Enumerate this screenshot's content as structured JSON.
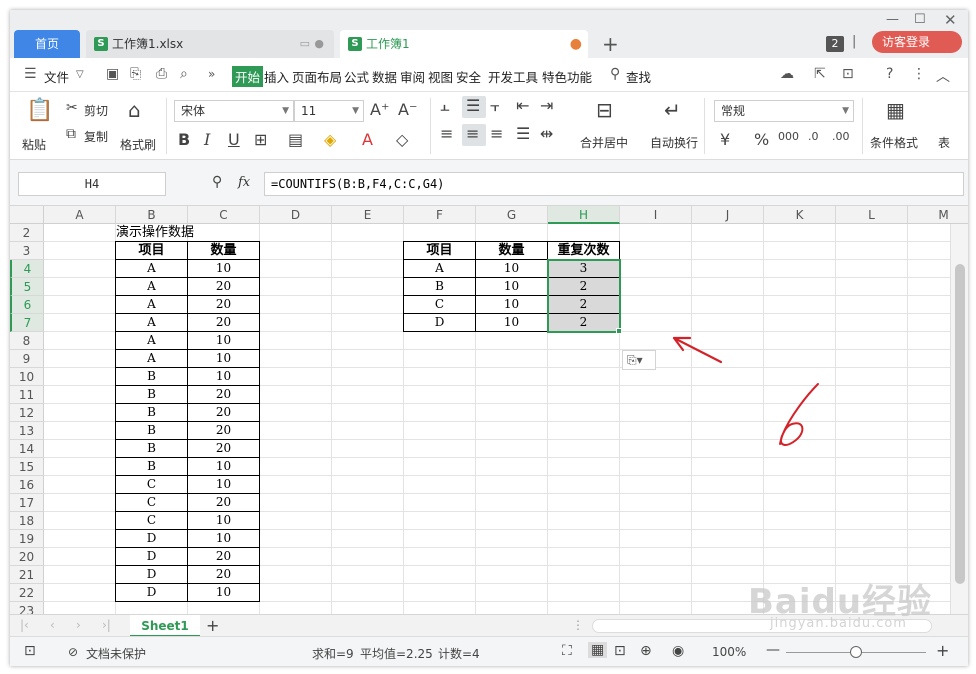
{
  "tabs": {
    "home": "首页",
    "doc1": "工作簿1.xlsx",
    "doc2": "工作簿1",
    "more": "»",
    "add": "+",
    "window_count": "2",
    "login": "访客登录"
  },
  "menu": {
    "file": "文件",
    "items": [
      "开始",
      "插入",
      "页面布局",
      "公式",
      "数据",
      "审阅",
      "视图",
      "安全",
      "开发工具",
      "特色功能"
    ],
    "search": "查找"
  },
  "ribbon": {
    "paste": "粘贴",
    "cut": "剪切",
    "copy": "复制",
    "format_painter": "格式刷",
    "font_name": "宋体",
    "font_size": "11",
    "merge_center": "合并居中",
    "wrap_text": "自动换行",
    "number_format": "常规",
    "conditional_format": "条件格式",
    "table": "表"
  },
  "formula_bar": {
    "name_box": "H4",
    "fx": "fx",
    "formula": "=COUNTIFS(B:B,F4,C:C,G4)"
  },
  "columns": [
    "A",
    "B",
    "C",
    "D",
    "E",
    "F",
    "G",
    "H",
    "I",
    "J",
    "K",
    "L",
    "M"
  ],
  "rows": [
    "2",
    "3",
    "4",
    "5",
    "6",
    "7",
    "8",
    "9",
    "10",
    "11",
    "12",
    "13",
    "14",
    "15",
    "16",
    "17",
    "18",
    "19",
    "20",
    "21",
    "22",
    "23"
  ],
  "sheet": {
    "title": "演示操作数据",
    "left_table": {
      "headers": [
        "项目",
        "数量"
      ],
      "rows": [
        [
          "A",
          "10"
        ],
        [
          "A",
          "20"
        ],
        [
          "A",
          "20"
        ],
        [
          "A",
          "20"
        ],
        [
          "A",
          "10"
        ],
        [
          "A",
          "10"
        ],
        [
          "B",
          "10"
        ],
        [
          "B",
          "20"
        ],
        [
          "B",
          "20"
        ],
        [
          "B",
          "20"
        ],
        [
          "B",
          "20"
        ],
        [
          "B",
          "10"
        ],
        [
          "C",
          "10"
        ],
        [
          "C",
          "20"
        ],
        [
          "C",
          "10"
        ],
        [
          "D",
          "10"
        ],
        [
          "D",
          "20"
        ],
        [
          "D",
          "20"
        ],
        [
          "D",
          "10"
        ]
      ]
    },
    "right_table": {
      "headers": [
        "项目",
        "数量",
        "重复次数"
      ],
      "rows": [
        [
          "A",
          "10",
          "3"
        ],
        [
          "B",
          "10",
          "2"
        ],
        [
          "C",
          "10",
          "2"
        ],
        [
          "D",
          "10",
          "2"
        ]
      ]
    }
  },
  "sheet_tabs": {
    "active": "Sheet1",
    "add": "+"
  },
  "status": {
    "protect": "文档未保护",
    "sum": "求和=9",
    "average": "平均值=2.25",
    "count": "计数=4",
    "zoom": "100%"
  },
  "watermark": {
    "brand": "Baidu经验",
    "url": "jingyan.baidu.com"
  },
  "colors": {
    "accent": "#2e9a55",
    "home_tab": "#3f86e6",
    "login": "#e05b54",
    "annotation": "#d3232a"
  }
}
